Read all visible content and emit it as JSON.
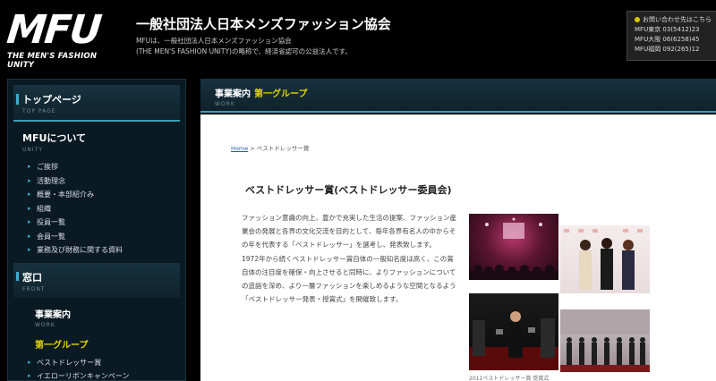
{
  "header": {
    "logo_text": "MFU",
    "logo_tagline": "THE MEN'S FASHION UNITY",
    "org_title": "一般社団法人日本メンズファッション協会",
    "org_desc_line1": "MFUは、一般社団法人日本メンズファッション協会",
    "org_desc_line2": "(THE MEN'S FASHION UNITY)の略称で、経済省認可の公益法人です。"
  },
  "contact": {
    "heading": "お問い合わせ先はこちら",
    "lines": [
      "MFU東京 03(5412)23",
      "MFU大阪 06(6258)45",
      "MFU福岡 092(265)12"
    ]
  },
  "sidebar": {
    "top": {
      "title": "トップページ",
      "sub": "TOP PAGE"
    },
    "unity": {
      "title": "MFUについて",
      "sub": "UNITY"
    },
    "unity_items": [
      "ご挨拶",
      "活動理念",
      "概要・本部紹介み",
      "組織",
      "役員一覧",
      "会員一覧",
      "業務及び財務に関する資料"
    ],
    "front": {
      "title": "窓口",
      "sub": "FRONT"
    },
    "work": {
      "title": "事業案内",
      "sub": "WORK"
    },
    "group1": "第一グループ",
    "group1_items": [
      "ベストドレッサー賞",
      "イエローリボンキャンペーン"
    ]
  },
  "main": {
    "banner_title": "事業案内",
    "banner_group": "第一グループ",
    "banner_sub": "WORK",
    "crumb_home": "Home",
    "crumb_rest": " > ベストドレッサー賞",
    "heading": "ベストドレッサー賞(ベストドレッサー委員会)",
    "paragraphs": [
      "ファッション意識の向上、豊かで充実した生活の提案、ファッション産業会の発展と各界の文化交流を目的として、毎年各界有名人の中からその年を代表する「ベストドレッサー」を選考し、発表致します。",
      "1972年から続くベストドレッサー賞自体の一般知名度は高く、この賞自体の注目度を確保・向上させると同時に、よりファッションについての造詣を深め、より一層ファッションを楽しめるような空間となるよう「ベストドレッサー発表・授賞式」を開催致します。"
    ],
    "caption": "2011ベストドレッサー賞 受賞式"
  }
}
